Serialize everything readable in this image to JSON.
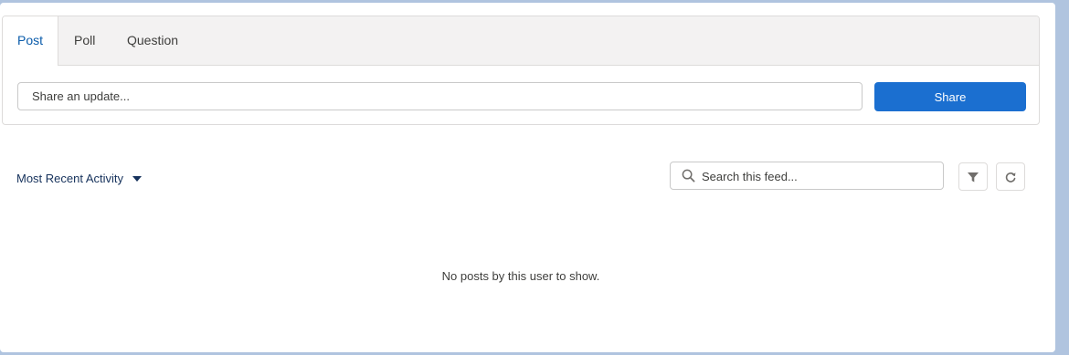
{
  "publisher": {
    "tabs": [
      {
        "label": "Post",
        "active": true
      },
      {
        "label": "Poll",
        "active": false
      },
      {
        "label": "Question",
        "active": false
      }
    ],
    "input_placeholder": "Share an update...",
    "share_label": "Share"
  },
  "feed": {
    "sort_label": "Most Recent Activity",
    "search_placeholder": "Search this feed...",
    "filter_icon": "filter-icon",
    "refresh_icon": "refresh-icon",
    "empty_message": "No posts by this user to show."
  },
  "colors": {
    "accent": "#1b6fd0",
    "active_tab": "#0b5cab",
    "link_text": "#16325c",
    "window_background": "#b0c4df"
  }
}
